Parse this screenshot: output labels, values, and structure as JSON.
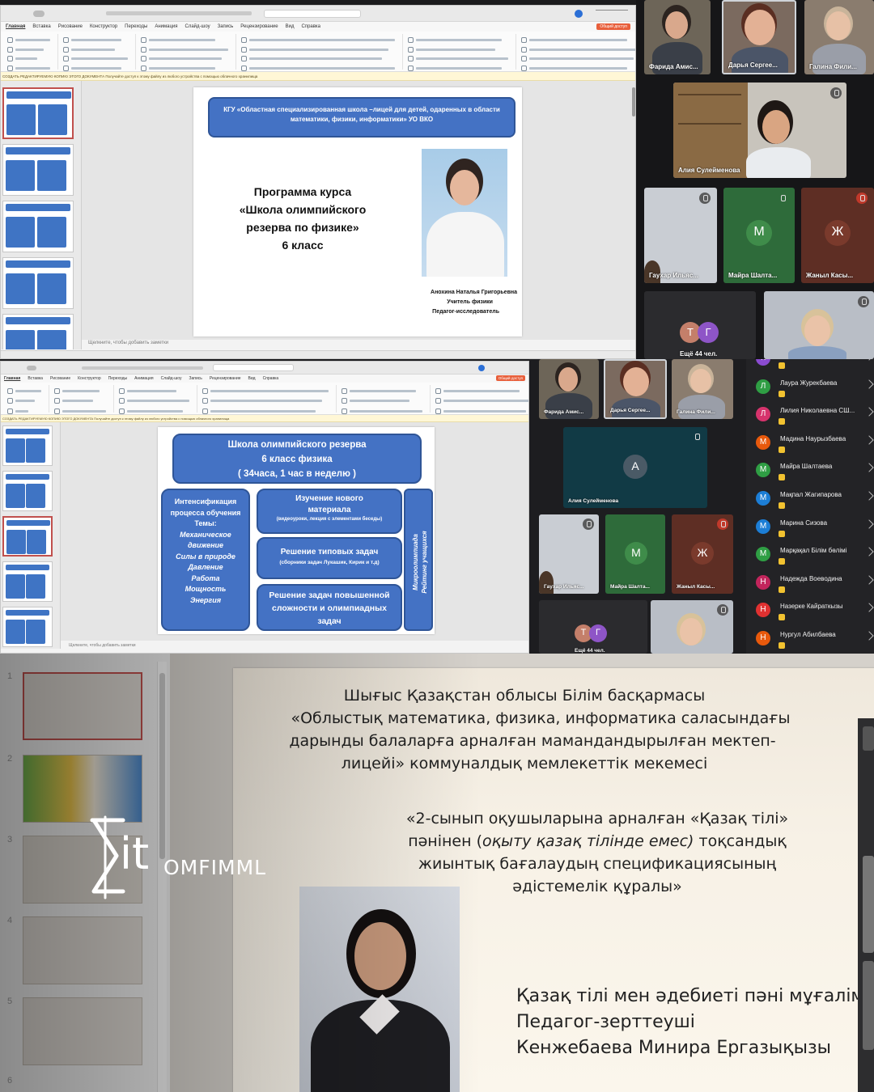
{
  "top_window": {
    "menu": [
      "Главная",
      "Вставка",
      "Рисование",
      "Конструктор",
      "Переходы",
      "Анимация",
      "Слайд-шоу",
      "Запись",
      "Рецензирование",
      "Вид",
      "Справка"
    ],
    "share_label": "Общий доступ",
    "warning": "СОЗДАТЬ РЕДАКТИРУЕМУЮ КОПИЮ ЭТОГО ДОКУМЕНТА   Получайте доступ к этому файлу из любого устройства с помощью облачного хранилища",
    "slide": {
      "header": "КГУ «Областная специализированная школа –лицей для детей, одаренных в области математики, физики, информатики»  УО ВКО",
      "title_lines": [
        "Программа курса",
        "«Школа олимпийского",
        "резерва по физике»",
        "6 класс"
      ],
      "author_name": "Анохина Наталья Григорьевна",
      "author_role": "Учитель физики",
      "author_title": "Педагог-исследователь"
    },
    "notes_placeholder": "Щелкните, чтобы добавить заметки"
  },
  "top_video": {
    "tiles": [
      {
        "name": "Фарида Амис...",
        "color": "#6d6558"
      },
      {
        "name": "Дарья Сергее...",
        "color": "#7b6a5f"
      },
      {
        "name": "Галина Фили...",
        "color": "#8a7c6e"
      },
      {
        "name": "Алия Сулейменова",
        "color": "#7c6a52"
      },
      {
        "name": "Гаухар Ильяс...",
        "color": "#c9cdd3"
      },
      {
        "name": "Майра Шалта...",
        "letter": "М",
        "color": "#2e6b3a",
        "avatar_color": "#3f8c4a"
      },
      {
        "name": "Жаныл Касы...",
        "letter": "Ж",
        "color": "#5e2e24",
        "avatar_color": "#7a3a2c"
      },
      {
        "name": "Ещё 44 чел.",
        "letters": [
          "Т",
          "Г"
        ],
        "color": "#2b2b2e"
      }
    ]
  },
  "middle_window": {
    "menu": [
      "Главная",
      "Вставка",
      "Рисование",
      "Конструктор",
      "Переходы",
      "Анимация",
      "Слайд-шоу",
      "Запись",
      "Рецензирование",
      "Вид",
      "Справка"
    ],
    "share_label": "Общий доступ",
    "slide": {
      "header_lines": [
        "Школа олимпийского резерва",
        "6 класс физика",
        "( 34часа, 1 час в неделю )"
      ],
      "left_box_title": "Интенсификация процесса обучения",
      "left_box_themes_label": "Темы:",
      "left_box_themes": [
        "Механическое",
        "движение",
        "Силы в природе",
        "Давление",
        "Работа",
        "Мощность",
        "Энергия"
      ],
      "box1_title": "Изучение нового материала",
      "box1_sub": "(видеоуроки, лекция с элементами беседы)",
      "box2_title": "Решение типовых задач",
      "box2_sub": "(сборники задач Лукашик, Кирик и т.д)",
      "box3_title": "Решение задач повышенной сложности и олимпиадных задач",
      "vertical_1": "Микроолимпиада",
      "vertical_2": "Рейтинг учащихся"
    },
    "notes_placeholder": "Щелкните, чтобы добавить заметки"
  },
  "middle_video": {
    "tiles": [
      {
        "name": "Фарида Амис..."
      },
      {
        "name": "Дарья Сергее..."
      },
      {
        "name": "Галина Фили..."
      },
      {
        "name": "Алия Сулейменова",
        "letter": "А"
      },
      {
        "name": "Гаухар Ильяс..."
      },
      {
        "name": "Майра Шалта...",
        "letter": "М"
      },
      {
        "name": "Жаныл Касы...",
        "letter": "Ж"
      },
      {
        "name": "Ещё 44 чел.",
        "letters": [
          "Т",
          "Г"
        ]
      }
    ]
  },
  "participants": [
    {
      "letter": "К",
      "name": "",
      "color": "#8a4bd0"
    },
    {
      "letter": "Л",
      "name": "Лаура Журекбаева",
      "color": "#2f9e44"
    },
    {
      "letter": "Л",
      "name": "Лилия Николаевна СШ...",
      "color": "#d6336c"
    },
    {
      "letter": "М",
      "name": "Мадина Наурызбаева",
      "color": "#e8590c"
    },
    {
      "letter": "М",
      "name": "Майра Шалтаева",
      "color": "#2f9e44"
    },
    {
      "letter": "М",
      "name": "Мақпал Жагипарова",
      "color": "#1c7ed6"
    },
    {
      "letter": "М",
      "name": "Марина Сизова",
      "color": "#1c7ed6"
    },
    {
      "letter": "М",
      "name": "Марқақал Білім бөлімі",
      "color": "#2f9e44"
    },
    {
      "letter": "Н",
      "name": "Надежда Воеводина",
      "color": "#c2255c"
    },
    {
      "letter": "Н",
      "name": "Назерке Кайраткызы",
      "color": "#e03131"
    },
    {
      "letter": "Н",
      "name": "Нургул Абилбаева",
      "color": "#e8590c"
    }
  ],
  "bottom": {
    "thumb_numbers": [
      "1",
      "2",
      "3",
      "4",
      "5",
      "6"
    ],
    "logo_text": "OMFIMML",
    "logo_mark": "it",
    "slide": {
      "header_lines": [
        "Шығыс Қазақстан облысы Білім басқармасы",
        "«Облыстық математика, физика, информатика саласындағы",
        "дарынды балаларға арналған мамандандырылған мектеп-",
        "лицейі» коммуналдық мемлекеттік мекемесі"
      ],
      "title_line1": "«2-сынып оқушыларына арналған «Қазақ тілі»",
      "title_line2_pre": "пәнінен (",
      "title_line2_italic": "оқыту қазақ тілінде емес)",
      "title_line2_post": " тоқсандық",
      "title_line3": "жиынтық бағалаудың спецификациясының",
      "title_line4": "әдістемелік құралы»",
      "author_lines": [
        "Қазақ тілі мен әдебиеті пәні мұғалімі",
        "Педагог-зерттеуші",
        "Кенжебаева Минира Ергазықызы"
      ]
    }
  }
}
